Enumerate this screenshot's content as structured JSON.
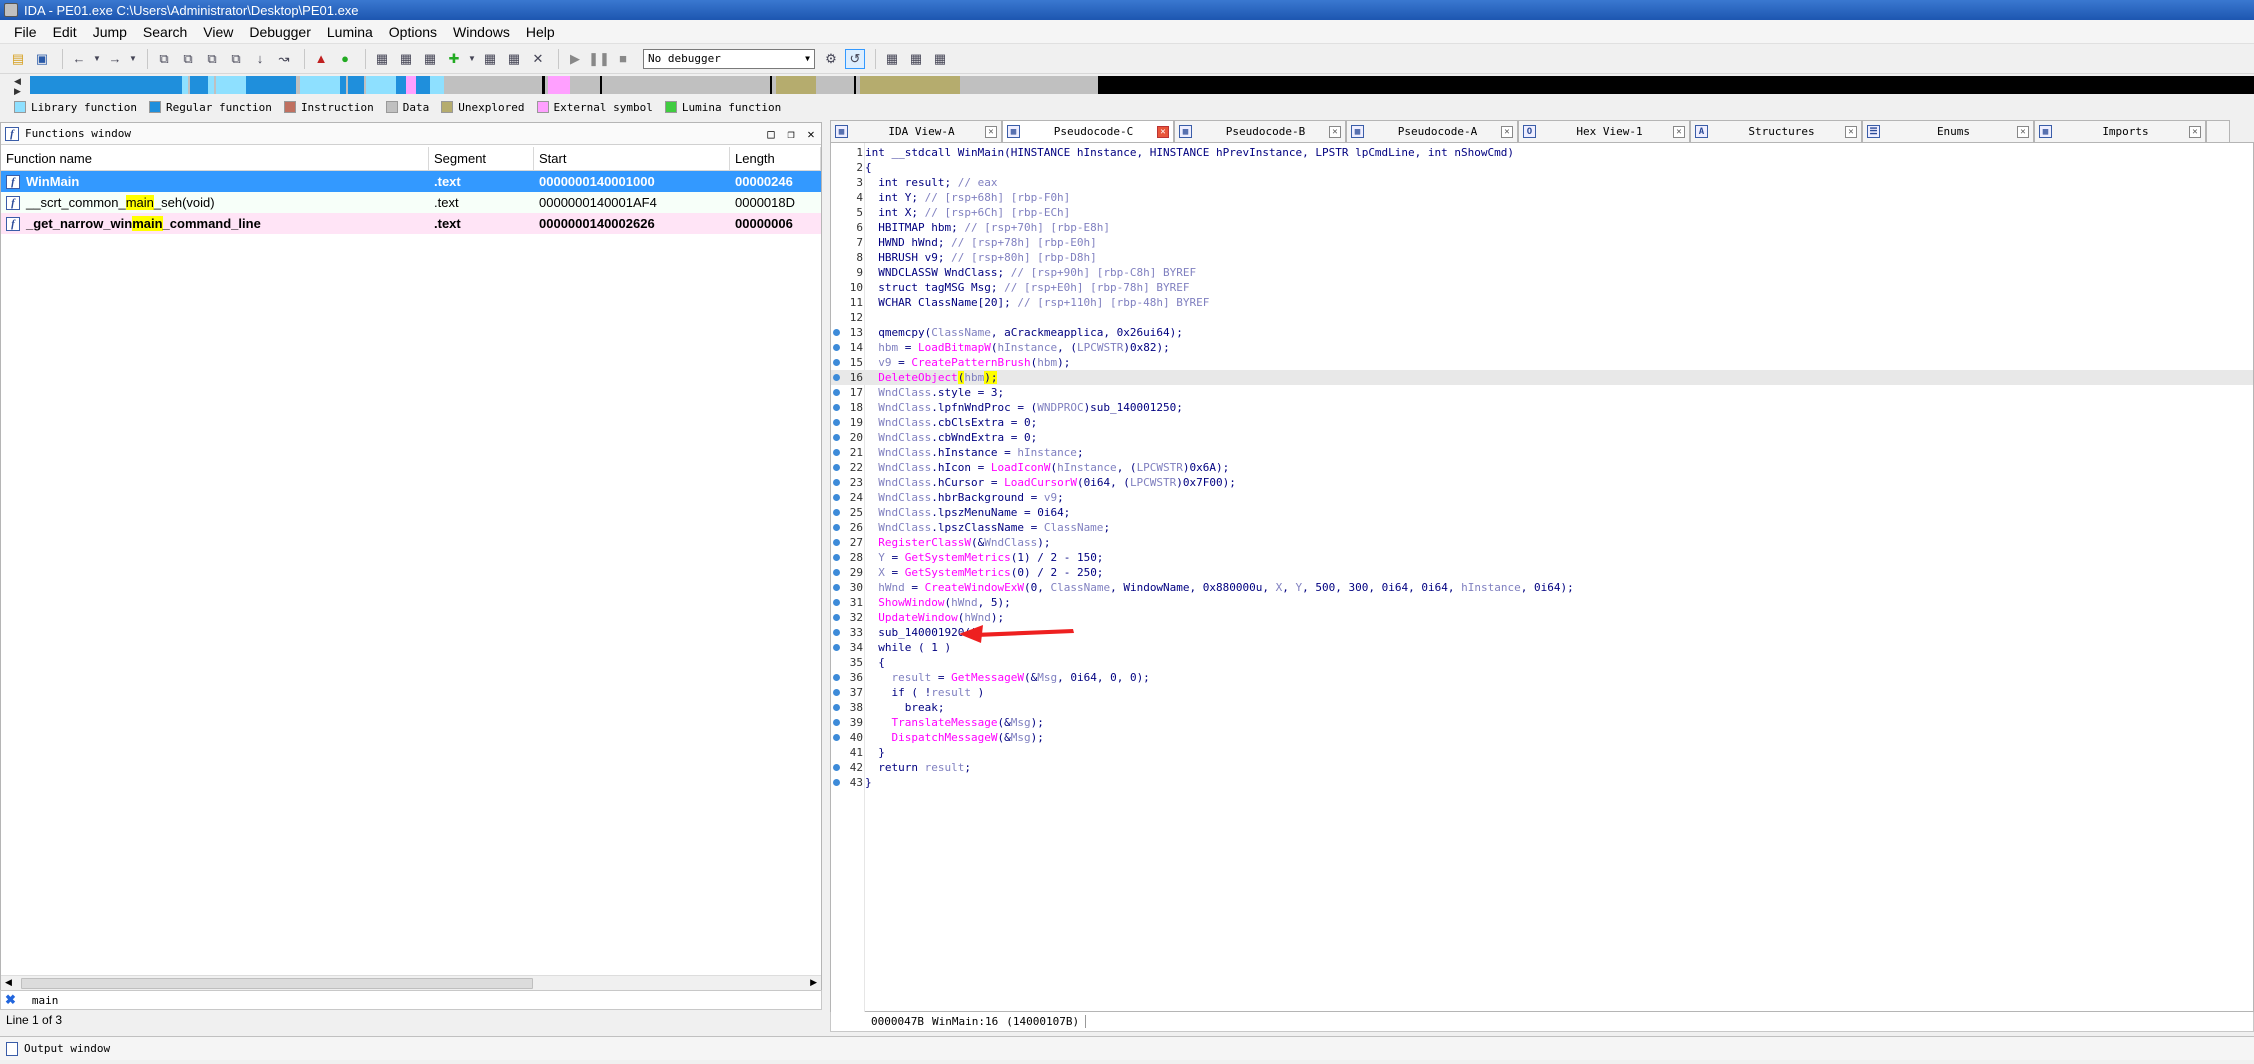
{
  "window": {
    "title": "IDA - PE01.exe C:\\Users\\Administrator\\Desktop\\PE01.exe"
  },
  "menu": [
    "File",
    "Edit",
    "Jump",
    "Search",
    "View",
    "Debugger",
    "Lumina",
    "Options",
    "Windows",
    "Help"
  ],
  "toolbar": {
    "debugger_select": "No debugger"
  },
  "legend": [
    {
      "label": "Library function",
      "color": "#8ee0ff"
    },
    {
      "label": "Regular function",
      "color": "#1f8fdc"
    },
    {
      "label": "Instruction",
      "color": "#c07060"
    },
    {
      "label": "Data",
      "color": "#c0c0c0"
    },
    {
      "label": "Unexplored",
      "color": "#b5ac6e"
    },
    {
      "label": "External symbol",
      "color": "#ffa0ff"
    },
    {
      "label": "Lumina function",
      "color": "#40cc40"
    }
  ],
  "functions_window": {
    "title": "Functions window",
    "columns": [
      "Function name",
      "Segment",
      "Start",
      "Length"
    ],
    "rows": [
      {
        "name": "WinMain",
        "segment": ".text",
        "start": "0000000140001000",
        "length": "00000246"
      },
      {
        "name_a": "__scrt_common_",
        "name_hl": "main",
        "name_b": "_seh(void)",
        "segment": ".text",
        "start": "0000000140001AF4",
        "length": "0000018D"
      },
      {
        "name_a": "_get_narrow_win",
        "name_hl": "main",
        "name_b": "_command_line",
        "segment": ".text",
        "start": "0000000140002626",
        "length": "00000006"
      }
    ],
    "search_text": "main",
    "line_info": "Line 1 of 3"
  },
  "tabs": [
    {
      "label": "IDA View-A",
      "icon": "ida-view-icon"
    },
    {
      "label": "Pseudocode-C",
      "icon": "pseudocode-icon",
      "active": true
    },
    {
      "label": "Pseudocode-B",
      "icon": "pseudocode-icon"
    },
    {
      "label": "Pseudocode-A",
      "icon": "pseudocode-icon"
    },
    {
      "label": "Hex View-1",
      "icon": "hex-icon"
    },
    {
      "label": "Structures",
      "icon": "struct-icon"
    },
    {
      "label": "Enums",
      "icon": "enum-icon"
    },
    {
      "label": "Imports",
      "icon": "imports-icon"
    }
  ],
  "code": {
    "signature": "int __stdcall WinMain(HINSTANCE hInstance, HINSTANCE hPrevInstance, LPSTR lpCmdLine, int nShowCmd)",
    "lines": {
      "l2": "{",
      "l3a": "  int result; ",
      "l3c": "// eax",
      "l4a": "  int Y; ",
      "l4c": "// [rsp+68h] [rbp-F0h]",
      "l5a": "  int X; ",
      "l5c": "// [rsp+6Ch] [rbp-ECh]",
      "l6a": "  HBITMAP hbm; ",
      "l6c": "// [rsp+70h] [rbp-E8h]",
      "l7a": "  HWND hWnd; ",
      "l7c": "// [rsp+78h] [rbp-E0h]",
      "l8a": "  HBRUSH v9; ",
      "l8c": "// [rsp+80h] [rbp-D8h]",
      "l9a": "  WNDCLASSW WndClass; ",
      "l9c": "// [rsp+90h] [rbp-C8h] BYREF",
      "l10a": "  struct tagMSG Msg; ",
      "l10c": "// [rsp+E0h] [rbp-78h] BYREF",
      "l11a": "  WCHAR ClassName[20]; ",
      "l11c": "// [rsp+110h] [rbp-48h] BYREF",
      "l13a": "  qmemcpy(",
      "l13v": "ClassName",
      "l13b": ", aCrackmeapplica, 0x26ui64);",
      "l14v": "  hbm",
      "l14a": " = ",
      "l14f": "LoadBitmapW",
      "l14b": "(",
      "l14v2": "hInstance",
      "l14c": ", (",
      "l14v3": "LPCWSTR",
      "l14d": ")0x82);",
      "l15v": "  v9",
      "l15a": " = ",
      "l15f": "CreatePatternBrush",
      "l15b": "(",
      "l15v2": "hbm",
      "l15c": ");",
      "l16f": "  DeleteObject",
      "l16a": "(",
      "l16v": "hbm",
      "l16b": ");",
      "l17v": "  WndClass",
      "l17a": ".style = 3;",
      "l18v": "  WndClass",
      "l18a": ".lpfnWndProc = (",
      "l18v2": "WNDPROC",
      "l18b": ")sub_140001250;",
      "l19v": "  WndClass",
      "l19a": ".cbClsExtra = 0;",
      "l20v": "  WndClass",
      "l20a": ".cbWndExtra = 0;",
      "l21v": "  WndClass",
      "l21a": ".hInstance = ",
      "l21v2": "hInstance",
      "l21b": ";",
      "l22v": "  WndClass",
      "l22a": ".hIcon = ",
      "l22f": "LoadIconW",
      "l22b": "(",
      "l22v2": "hInstance",
      "l22c": ", (",
      "l22v3": "LPCWSTR",
      "l22d": ")0x6A);",
      "l23v": "  WndClass",
      "l23a": ".hCursor = ",
      "l23f": "LoadCursorW",
      "l23b": "(0i64, (",
      "l23v2": "LPCWSTR",
      "l23c": ")0x7F00);",
      "l24v": "  WndClass",
      "l24a": ".hbrBackground = ",
      "l24v2": "v9",
      "l24b": ";",
      "l25v": "  WndClass",
      "l25a": ".lpszMenuName = 0i64;",
      "l26v": "  WndClass",
      "l26a": ".lpszClassName = ",
      "l26v2": "ClassName",
      "l26b": ";",
      "l27f": "  RegisterClassW",
      "l27a": "(&",
      "l27v": "WndClass",
      "l27b": ");",
      "l28v": "  Y",
      "l28a": " = ",
      "l28f": "GetSystemMetrics",
      "l28b": "(1) / 2 - 150;",
      "l29v": "  X",
      "l29a": " = ",
      "l29f": "GetSystemMetrics",
      "l29b": "(0) / 2 - 250;",
      "l30v": "  hWnd",
      "l30a": " = ",
      "l30f": "CreateWindowExW",
      "l30b": "(0, ",
      "l30v2": "ClassName",
      "l30c": ", WindowName, 0x880000u, ",
      "l30v3": "X",
      "l30d": ", ",
      "l30v4": "Y",
      "l30e": ", 500, 300, 0i64, 0i64, ",
      "l30v5": "hInstance",
      "l30g": ", 0i64);",
      "l31f": "  ShowWindow",
      "l31a": "(",
      "l31v": "hWnd",
      "l31b": ", 5);",
      "l32f": "  UpdateWindow",
      "l32a": "(",
      "l32v": "hWnd",
      "l32b": ");",
      "l33": "  sub_140001920();",
      "l34": "  while ( 1 )",
      "l35": "  {",
      "l36v": "    result",
      "l36a": " = ",
      "l36f": "GetMessageW",
      "l36b": "(&",
      "l36v2": "Msg",
      "l36c": ", 0i64, 0, 0);",
      "l37a": "    if ( !",
      "l37v": "result",
      "l37b": " )",
      "l38": "      break;",
      "l39f": "    TranslateMessage",
      "l39a": "(&",
      "l39v": "Msg",
      "l39b": ");",
      "l40f": "    DispatchMessageW",
      "l40a": "(&",
      "l40v": "Msg",
      "l40b": ");",
      "l41": "  }",
      "l42a": "  return ",
      "l42v": "result",
      "l42b": ";",
      "l43": "}"
    }
  },
  "status": {
    "offset": "0000047B",
    "location": "WinMain:16",
    "address": "(14000107B)"
  },
  "output_window": {
    "title": "Output window"
  }
}
